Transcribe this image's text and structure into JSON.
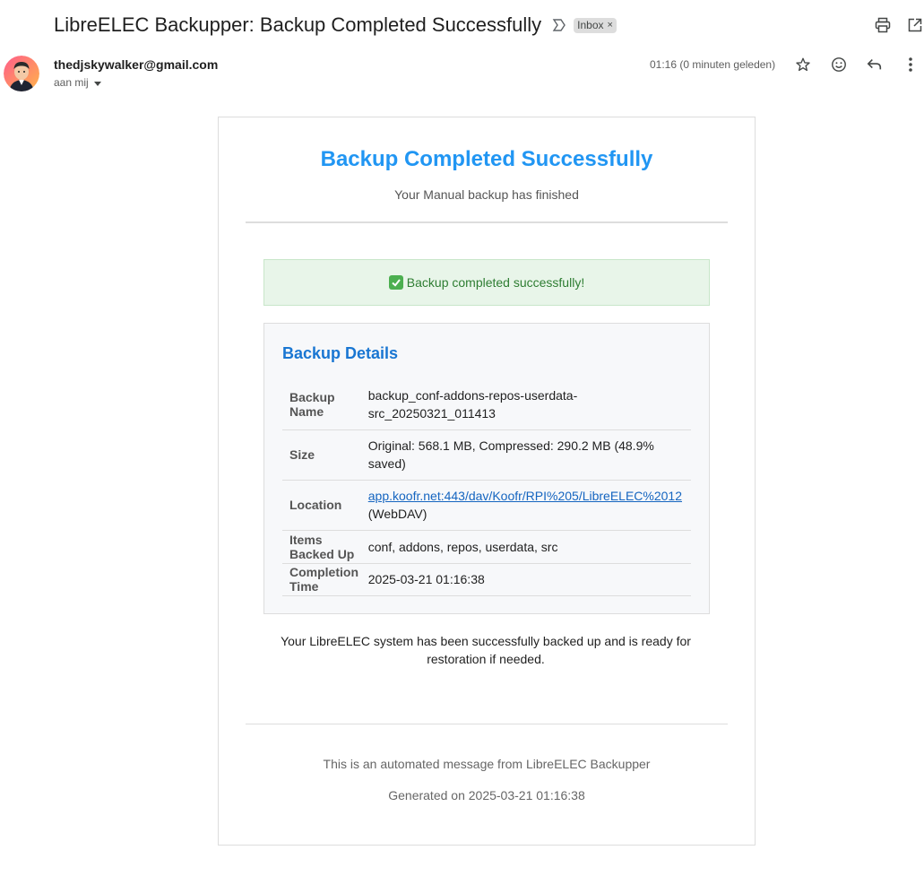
{
  "email": {
    "subject": "LibreELEC Backupper: Backup Completed Successfully",
    "label": "Inbox",
    "sender": "thedjskywalker@gmail.com",
    "recipient_line": "aan mij",
    "timestamp": "01:16 (0 minuten geleden)"
  },
  "icons": {
    "importance": "importance-marker-icon",
    "label_close": "close-icon",
    "print": "print-icon",
    "open_new_window": "open-in-new-window-icon",
    "star": "star-icon",
    "emoji_reaction": "smiley-icon",
    "reply": "reply-icon",
    "more": "more-vert-icon",
    "recipient_dropdown": "caret-down-icon",
    "success": "check-mark-button-icon"
  },
  "colors": {
    "title": "#2196f3",
    "details_title": "#1976d2",
    "success_bg": "#e8f5e9",
    "success_text": "#2e7d32",
    "link": "#1565c0"
  },
  "body": {
    "title": "Backup Completed Successfully",
    "subtitle": "Your Manual backup has finished",
    "success_message": "Backup completed successfully!",
    "details_title": "Backup Details",
    "details": [
      {
        "key": "Backup Name",
        "value": "backup_conf-addons-repos-userdata-src_20250321_011413"
      },
      {
        "key": "Size",
        "value": "Original: 568.1 MB, Compressed: 290.2 MB (48.9% saved)"
      },
      {
        "key": "Location",
        "link": "app.koofr.net:443/dav/Koofr/RPI%205/LibreELEC%2012",
        "suffix": " (WebDAV)"
      },
      {
        "key": "Items Backed Up",
        "value": "conf, addons, repos, userdata, src"
      },
      {
        "key": "Completion Time",
        "value": "2025-03-21 01:16:38"
      }
    ],
    "closing": "Your LibreELEC system has been successfully backed up and is ready for restoration if needed.",
    "footer_line1": "This is an automated message from LibreELEC Backupper",
    "footer_line2": "Generated on 2025-03-21 01:16:38"
  }
}
